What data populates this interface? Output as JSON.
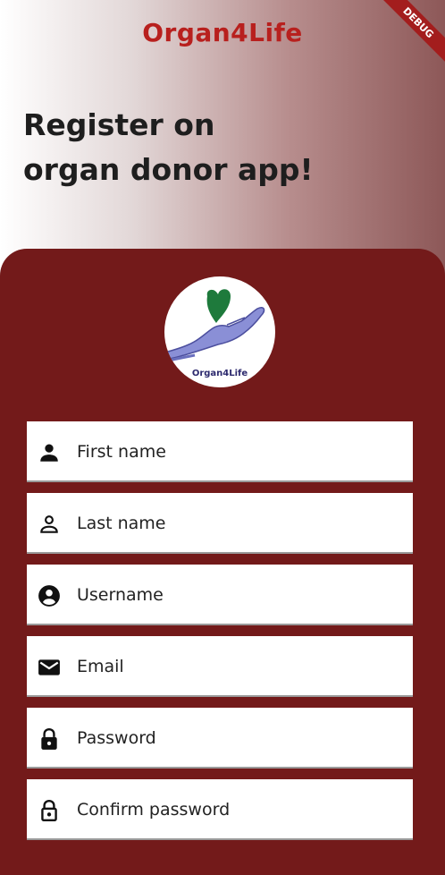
{
  "app": {
    "title": "Organ4Life",
    "debug_badge": "DEBUG"
  },
  "header": {
    "headline": "Register on organ donor app!"
  },
  "logo": {
    "label": "Organ4Life"
  },
  "form": {
    "fields": [
      {
        "icon": "person-icon",
        "label": "First name"
      },
      {
        "icon": "person-outline-icon",
        "label": "Last name"
      },
      {
        "icon": "account-circle-icon",
        "label": "Username"
      },
      {
        "icon": "mail-icon",
        "label": "Email"
      },
      {
        "icon": "lock-icon",
        "label": "Password"
      },
      {
        "icon": "lock-outline-icon",
        "label": "Confirm password"
      }
    ]
  },
  "colors": {
    "brand_red": "#b8201e",
    "panel": "#731a1a",
    "logo_heart": "#1e7a3c",
    "logo_hand": "#8a8fd6"
  }
}
